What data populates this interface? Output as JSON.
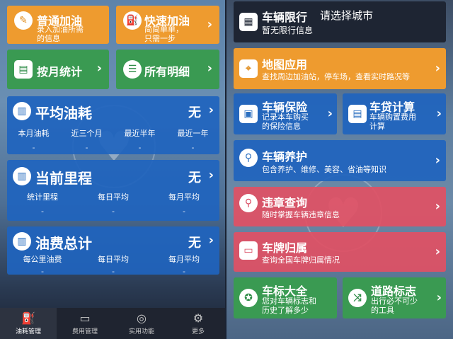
{
  "left": {
    "quick_tiles": [
      {
        "title": "普通加油",
        "sub1": "录入加油所需",
        "sub2": "的信息",
        "icon": "pencil-icon"
      },
      {
        "title": "快速加油",
        "sub1": "简简单单，",
        "sub2": "只需一步",
        "icon": "fuel-pump-icon"
      }
    ],
    "nav_tiles": [
      {
        "title": "按月统计",
        "icon": "calendar-list-icon"
      },
      {
        "title": "所有明细",
        "icon": "list-icon"
      }
    ],
    "avg_fuel": {
      "title": "平均油耗",
      "value": "无",
      "cols": [
        {
          "label": "本月油耗",
          "value": "-"
        },
        {
          "label": "近三个月",
          "value": "-"
        },
        {
          "label": "最近半年",
          "value": "-"
        },
        {
          "label": "最近一年",
          "value": "-"
        }
      ]
    },
    "mileage": {
      "title": "当前里程",
      "value": "无",
      "cols": [
        {
          "label": "统计里程",
          "value": "-"
        },
        {
          "label": "每日平均",
          "value": "-"
        },
        {
          "label": "每月平均",
          "value": "-"
        }
      ]
    },
    "fuel_cost": {
      "title": "油费总计",
      "value": "无",
      "cols": [
        {
          "label": "每公里油费",
          "value": "-"
        },
        {
          "label": "每日平均",
          "value": "-"
        },
        {
          "label": "每月平均",
          "value": "-"
        }
      ]
    },
    "tabs": [
      {
        "label": "油耗管理",
        "icon": "fuel-can-icon",
        "active": true
      },
      {
        "label": "费用管理",
        "icon": "wallet-icon",
        "active": false
      },
      {
        "label": "实用功能",
        "icon": "compass-icon",
        "active": false
      },
      {
        "label": "更多",
        "icon": "gear-icon",
        "active": false
      }
    ]
  },
  "right": {
    "restriction": {
      "title": "车辆限行",
      "city": "请选择城市",
      "sub": "暂无限行信息",
      "icon": "calendar-icon"
    },
    "map": {
      "title": "地图应用",
      "sub": "查找周边加油站，停车场，查看实时路况等",
      "icon": "map-pin-icon"
    },
    "insurance": {
      "title": "车辆保险",
      "sub1": "记录本车购买",
      "sub2": "的保险信息",
      "icon": "shield-card-icon"
    },
    "loan": {
      "title": "车贷计算",
      "sub1": "车辆购置费用",
      "sub2": "计算",
      "icon": "calculator-icon"
    },
    "maintenance": {
      "title": "车辆养护",
      "sub": "包含养护、维修、美容、省油等知识",
      "icon": "search-icon"
    },
    "violation": {
      "title": "违章查询",
      "sub": "随时掌握车辆违章信息",
      "icon": "search-icon"
    },
    "plate": {
      "title": "车牌归属",
      "sub": "查询全国车牌归属情况",
      "icon": "license-plate-icon"
    },
    "logo": {
      "title": "车标大全",
      "sub1": "您对车辆标志和",
      "sub2": "历史了解多少",
      "icon": "car-logo-icon"
    },
    "road_signs": {
      "title": "道路标志",
      "sub1": "出行必不可少",
      "sub2": "的工具",
      "icon": "road-sign-icon"
    }
  }
}
